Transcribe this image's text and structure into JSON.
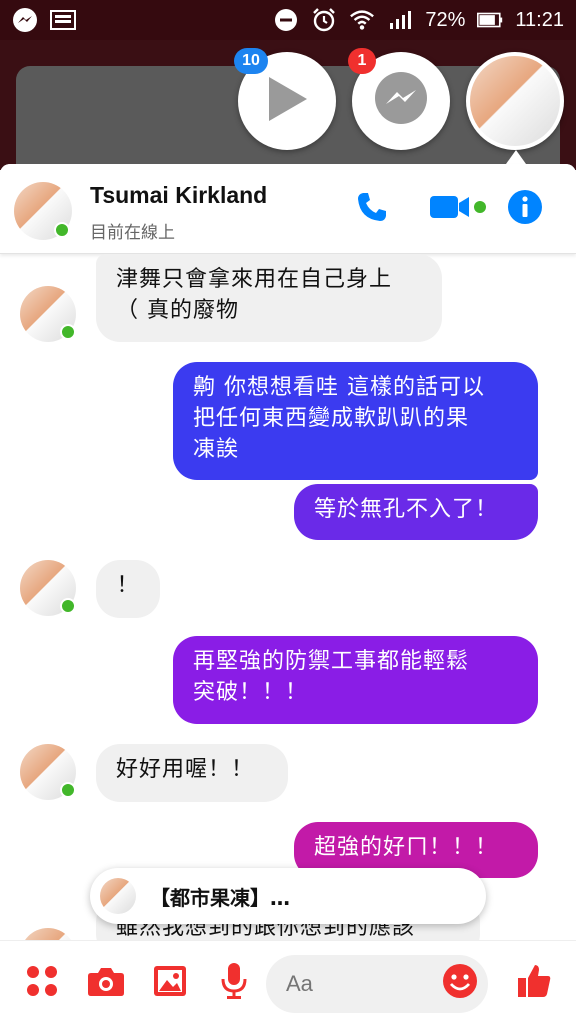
{
  "status_bar": {
    "battery": "72%",
    "time": "11:21"
  },
  "chat_heads": [
    {
      "name": "video-play",
      "badge": "10"
    },
    {
      "name": "messenger",
      "badge": "1"
    },
    {
      "name": "contact"
    }
  ],
  "header": {
    "name": "Tsumai Kirkland",
    "status": "目前在線上"
  },
  "messages": [
    {
      "side": "in",
      "lines": [
        "津舞只會拿來用在自己身上",
        "（ 真的廢物"
      ]
    },
    {
      "side": "out",
      "lines": [
        "齁 你想想看哇 這樣的話可以",
        "把任何東西變成軟趴趴的果",
        "凍誒"
      ]
    },
    {
      "side": "out",
      "lines": [
        "等於無孔不入了！"
      ]
    },
    {
      "side": "in",
      "lines": [
        "！"
      ]
    },
    {
      "side": "out",
      "lines": [
        "再堅強的防禦工事都能輕鬆",
        "突破！！！"
      ]
    },
    {
      "side": "in",
      "lines": [
        "好好用喔！！"
      ]
    },
    {
      "side": "out",
      "lines": [
        "超強的好ㄇ！！！"
      ]
    },
    {
      "side": "in",
      "lines": [
        "雖然我想到的跟你想到的應該"
      ]
    }
  ],
  "shared_preview": "【都市果凍】…",
  "composer": {
    "placeholder": "Aa"
  },
  "colors": {
    "accent": "#0084ff",
    "out_blue": "#3b3bf0",
    "out_purple": "#8a1de6",
    "out_magenta": "#c21aa8",
    "composer_red": "#f0302e"
  }
}
